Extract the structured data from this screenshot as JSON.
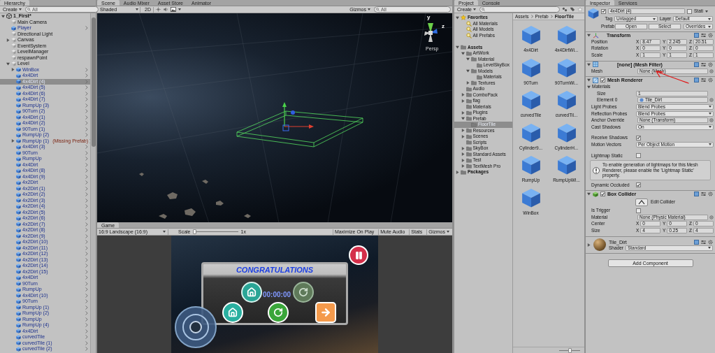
{
  "hierarchy": {
    "tabs": [
      {
        "label": "Hierarchy",
        "selected": true
      }
    ],
    "create": "Create",
    "search_placeholder": "All",
    "tree": [
      {
        "name": "1_First*",
        "kind": "scene",
        "expanded": true,
        "selected": false,
        "children": [
          {
            "name": "Main Camera",
            "kind": "object",
            "selected": false
          },
          {
            "name": "Player",
            "kind": "prefab",
            "selected": false
          },
          {
            "name": "Directional Light",
            "kind": "object",
            "selected": false
          },
          {
            "name": "Canvas",
            "kind": "object",
            "expanded": false,
            "selected": false
          },
          {
            "name": "EventSystem",
            "kind": "object",
            "selected": false
          },
          {
            "name": "LevelManager",
            "kind": "object",
            "selected": false
          },
          {
            "name": "respawnPoint",
            "kind": "object",
            "selected": false
          },
          {
            "name": "Level",
            "kind": "object",
            "expanded": true,
            "selected": false,
            "children": [
              {
                "name": "WinBox",
                "kind": "prefab",
                "expanded": false,
                "selected": false
              },
              {
                "name": "4x4Dirt",
                "kind": "prefab",
                "selected": false
              },
              {
                "name": "4x4Dirt (4)",
                "kind": "prefab",
                "selected": true
              },
              {
                "name": "4x4Dirt (5)",
                "kind": "prefab",
                "selected": false
              },
              {
                "name": "4x4Dirt (6)",
                "kind": "prefab",
                "selected": false
              },
              {
                "name": "4x4Dirt (7)",
                "kind": "prefab",
                "selected": false
              },
              {
                "name": "RumpUp (3)",
                "kind": "prefab",
                "selected": false
              },
              {
                "name": "90Turn (2)",
                "kind": "prefab",
                "selected": false
              },
              {
                "name": "4x4Dirt (1)",
                "kind": "prefab",
                "selected": false
              },
              {
                "name": "4x4Dirt (2)",
                "kind": "prefab",
                "selected": false
              },
              {
                "name": "90Turn (1)",
                "kind": "prefab",
                "selected": false
              },
              {
                "name": "RumpUp (2)",
                "kind": "prefab",
                "selected": false
              },
              {
                "name": "RumpUp (1)",
                "note": "(Missing Prefab)",
                "kind": "prefab",
                "expanded": false,
                "selected": false
              },
              {
                "name": "4x4Dirt (3)",
                "kind": "prefab",
                "selected": false
              },
              {
                "name": "90Turn",
                "kind": "prefab",
                "selected": false
              },
              {
                "name": "RumpUp",
                "kind": "prefab",
                "selected": false
              },
              {
                "name": "4x4Dirt",
                "kind": "prefab",
                "selected": false
              },
              {
                "name": "4x4Dirt (8)",
                "kind": "prefab",
                "selected": false
              },
              {
                "name": "4x4Dirt (9)",
                "kind": "prefab",
                "selected": false
              },
              {
                "name": "4x2Dirt",
                "kind": "prefab",
                "selected": false
              },
              {
                "name": "4x2Dirt (1)",
                "kind": "prefab",
                "selected": false
              },
              {
                "name": "4x2Dirt (2)",
                "kind": "prefab",
                "selected": false
              },
              {
                "name": "4x2Dirt (3)",
                "kind": "prefab",
                "selected": false
              },
              {
                "name": "4x2Dirt (4)",
                "kind": "prefab",
                "selected": false
              },
              {
                "name": "4x2Dirt (5)",
                "kind": "prefab",
                "selected": false
              },
              {
                "name": "4x2Dirt (6)",
                "kind": "prefab",
                "selected": false
              },
              {
                "name": "4x2Dirt (7)",
                "kind": "prefab",
                "selected": false
              },
              {
                "name": "4x2Dirt (8)",
                "kind": "prefab",
                "selected": false
              },
              {
                "name": "4x2Dirt (9)",
                "kind": "prefab",
                "selected": false
              },
              {
                "name": "4x2Dirt (10)",
                "kind": "prefab",
                "selected": false
              },
              {
                "name": "4x2Dirt (11)",
                "kind": "prefab",
                "selected": false
              },
              {
                "name": "4x2Dirt (12)",
                "kind": "prefab",
                "selected": false
              },
              {
                "name": "4x2Dirt (13)",
                "kind": "prefab",
                "selected": false
              },
              {
                "name": "4x2Dirt (14)",
                "kind": "prefab",
                "selected": false
              },
              {
                "name": "4x2Dirt (15)",
                "kind": "prefab",
                "selected": false
              },
              {
                "name": "4x4Dirt",
                "kind": "prefab",
                "selected": false
              },
              {
                "name": "90Turn",
                "kind": "prefab",
                "selected": false
              },
              {
                "name": "RumpUp",
                "kind": "prefab",
                "selected": false
              },
              {
                "name": "4x4Dirt (10)",
                "kind": "prefab",
                "selected": false
              },
              {
                "name": "90Turn",
                "kind": "prefab",
                "selected": false
              },
              {
                "name": "RumpUp (1)",
                "kind": "prefab",
                "selected": false
              },
              {
                "name": "RumpUp (2)",
                "kind": "prefab",
                "selected": false
              },
              {
                "name": "RumpUp",
                "kind": "prefab",
                "selected": false
              },
              {
                "name": "RumpUp (4)",
                "kind": "prefab",
                "selected": false
              },
              {
                "name": "4x4Dirt",
                "kind": "prefab",
                "selected": false
              },
              {
                "name": "curvedTile",
                "kind": "prefab",
                "selected": false
              },
              {
                "name": "curvedTile (1)",
                "kind": "prefab",
                "selected": false
              },
              {
                "name": "curvedTile (2)",
                "kind": "prefab",
                "selected": false
              }
            ]
          }
        ]
      }
    ]
  },
  "scene": {
    "tabs": [
      {
        "label": "Scene",
        "selected": true
      },
      {
        "label": "Audio Mixer",
        "selected": false
      },
      {
        "label": "Asset Store",
        "selected": false
      },
      {
        "label": "Animator",
        "selected": false
      }
    ],
    "shading": "Shaded",
    "mode_2d": "2D",
    "gizmos": "Gizmos",
    "search_placeholder": "All",
    "projection": "Persp",
    "axis_labels": [
      "y",
      "z"
    ]
  },
  "game": {
    "tabs": [
      {
        "label": "Game",
        "selected": true
      }
    ],
    "aspect": "16:9 Landscape (16:9)",
    "scale": {
      "label": "Scale",
      "level": 0.03,
      "value": "1x"
    },
    "buttons": [
      "Maximize On Play",
      "Mute Audio",
      "Stats"
    ],
    "gizmos": "Gizmos",
    "popup": {
      "title": "CONGRATULATIONS",
      "timer": "00:00:00"
    }
  },
  "project": {
    "tabs": [
      {
        "label": "Project",
        "selected": true
      },
      {
        "label": "Console",
        "selected": false
      }
    ],
    "create": "Create",
    "tree": [
      {
        "name": "Favorites",
        "kind": "favorites",
        "expanded": true,
        "selected": false,
        "children": [
          {
            "name": "All Materials",
            "kind": "search",
            "selected": false
          },
          {
            "name": "All Models",
            "kind": "search",
            "selected": false
          },
          {
            "name": "All Prefabs",
            "kind": "search",
            "selected": false
          }
        ]
      },
      {
        "name": "Assets",
        "kind": "root",
        "expanded": true,
        "selected": false,
        "children": [
          {
            "name": "ArtWork",
            "kind": "folder",
            "expanded": true,
            "selected": false,
            "children": [
              {
                "name": "Material",
                "kind": "folder",
                "expanded": true,
                "selected": false,
                "children": [
                  {
                    "name": "LevelSkyBox",
                    "kind": "folder",
                    "selected": false
                  }
                ]
              },
              {
                "name": "Models",
                "kind": "folder",
                "expanded": true,
                "selected": false,
                "children": [
                  {
                    "name": "Materials",
                    "kind": "folder",
                    "selected": false
                  }
                ]
              },
              {
                "name": "Textures",
                "kind": "folder",
                "expanded": false,
                "selected": false
              }
            ]
          },
          {
            "name": "Audio",
            "kind": "folder",
            "selected": false
          },
          {
            "name": "ComboPack",
            "kind": "folder",
            "expanded": false,
            "selected": false
          },
          {
            "name": "flag",
            "kind": "folder",
            "expanded": false,
            "selected": false
          },
          {
            "name": "Materials",
            "kind": "folder",
            "selected": false
          },
          {
            "name": "Plugins",
            "kind": "folder",
            "expanded": false,
            "selected": false
          },
          {
            "name": "Prefab",
            "kind": "folder",
            "expanded": true,
            "selected": false,
            "children": [
              {
                "name": "FloorTile",
                "kind": "folder",
                "selected": true
              }
            ]
          },
          {
            "name": "Resources",
            "kind": "folder",
            "expanded": false,
            "selected": false
          },
          {
            "name": "Scenes",
            "kind": "folder",
            "expanded": false,
            "selected": false
          },
          {
            "name": "Scripts",
            "kind": "folder",
            "selected": false
          },
          {
            "name": "SkyBox",
            "kind": "folder",
            "expanded": false,
            "selected": false
          },
          {
            "name": "Standard Assets",
            "kind": "folder",
            "expanded": false,
            "selected": false
          },
          {
            "name": "Test",
            "kind": "folder",
            "expanded": false,
            "selected": false
          },
          {
            "name": "TextMesh Pro",
            "kind": "folder",
            "expanded": false,
            "selected": false
          }
        ]
      },
      {
        "name": "Packages",
        "kind": "root",
        "expanded": false,
        "selected": false
      }
    ],
    "breadcrumb": [
      "Assets",
      "Prefab",
      "FloorTile"
    ],
    "assets": [
      "4x4Dirt",
      "4x4DirtWi...",
      "90Turn",
      "90TurnWi...",
      "curvedTile",
      "curvedTil...",
      "Cylinder9...",
      "CylinderH...",
      "RumpUp",
      "RumpUpWi...",
      "WinBox"
    ],
    "icon_size": {
      "level": 0.5
    }
  },
  "inspector": {
    "tabs": [
      {
        "label": "Inspector",
        "selected": true
      },
      {
        "label": "Services",
        "selected": false
      }
    ],
    "header": {
      "active": true,
      "name": "4x4Dirt (4)",
      "static_label": "Stati",
      "static": false,
      "tag_label": "Tag",
      "tag": "Untagged",
      "layer_label": "Layer",
      "layer": "Default",
      "prefab_label": "Prefab",
      "prefab_buttons": [
        "Open",
        "Select"
      ],
      "overrides": "Overrides"
    },
    "components": [
      {
        "kind": "transform",
        "title": "Transform",
        "expanded": true,
        "rows": [
          {
            "kind": "vector",
            "label": "Position",
            "values": [
              {
                "axis": "X",
                "value": "8.47"
              },
              {
                "axis": "Y",
                "value": "2.245"
              },
              {
                "axis": "Z",
                "value": "20.51"
              }
            ]
          },
          {
            "kind": "vector",
            "label": "Rotation",
            "values": [
              {
                "axis": "X",
                "value": "0"
              },
              {
                "axis": "Y",
                "value": "0"
              },
              {
                "axis": "Z",
                "value": "0"
              }
            ]
          },
          {
            "kind": "vector",
            "label": "Scale",
            "values": [
              {
                "axis": "X",
                "value": "1"
              },
              {
                "axis": "Y",
                "value": "1"
              },
              {
                "axis": "Z",
                "value": "1"
              }
            ]
          }
        ]
      },
      {
        "kind": "mesh_filter",
        "title": "[none] (Mesh Filter)",
        "expanded": true,
        "rows": [
          {
            "kind": "object",
            "label": "Mesh",
            "value": "None (Mesh)"
          }
        ]
      },
      {
        "kind": "mesh_renderer",
        "title": "Mesh Renderer",
        "enabled": true,
        "expanded": true,
        "rows": [
          {
            "kind": "group",
            "label": "Materials",
            "expanded": true,
            "children": [
              {
                "kind": "number",
                "label": "Size",
                "value": "1"
              },
              {
                "kind": "object",
                "label": "Element 0",
                "value": "Tile_Dirt",
                "asset": true
              }
            ]
          },
          {
            "kind": "dropdown",
            "label": "Light Probes",
            "value": "Blend Probes"
          },
          {
            "kind": "dropdown",
            "label": "Reflection Probes",
            "value": "Blend Probes"
          },
          {
            "kind": "object",
            "label": "Anchor Override",
            "value": "None (Transform)"
          },
          {
            "kind": "dropdown",
            "label": "Cast Shadows",
            "value": "On"
          },
          {
            "kind": "toggle",
            "label": "Receive Shadows",
            "checked": true
          },
          {
            "kind": "dropdown",
            "label": "Motion Vectors",
            "value": "Per Object Motion"
          },
          {
            "kind": "toggle",
            "label": "Lightmap Static",
            "checked": false
          },
          {
            "kind": "info",
            "text": "To enable generation of lightmaps for this Mesh Renderer, please enable the 'Lightmap Static' property."
          },
          {
            "kind": "toggle",
            "label": "Dynamic Occluded",
            "checked": true
          }
        ]
      },
      {
        "kind": "box_collider",
        "title": "Box Collider",
        "enabled": true,
        "expanded": true,
        "rows": [
          {
            "kind": "button",
            "text": "Edit Collider"
          },
          {
            "kind": "toggle",
            "label": "Is Trigger",
            "checked": false
          },
          {
            "kind": "object",
            "label": "Material",
            "value": "None (Physic Material)"
          },
          {
            "kind": "vector",
            "label": "Center",
            "values": [
              {
                "axis": "X",
                "value": "0"
              },
              {
                "axis": "Y",
                "value": "0"
              },
              {
                "axis": "Z",
                "value": "0"
              }
            ]
          },
          {
            "kind": "vector",
            "label": "Size",
            "values": [
              {
                "axis": "X",
                "value": "4"
              },
              {
                "axis": "Y",
                "value": "0.25"
              },
              {
                "axis": "Z",
                "value": "4"
              }
            ]
          }
        ]
      },
      {
        "kind": "material",
        "title": "Tile_Dirt",
        "expanded": false,
        "shader_label": "Shader",
        "shader": "Standard"
      }
    ],
    "add_component": "Add Component"
  }
}
